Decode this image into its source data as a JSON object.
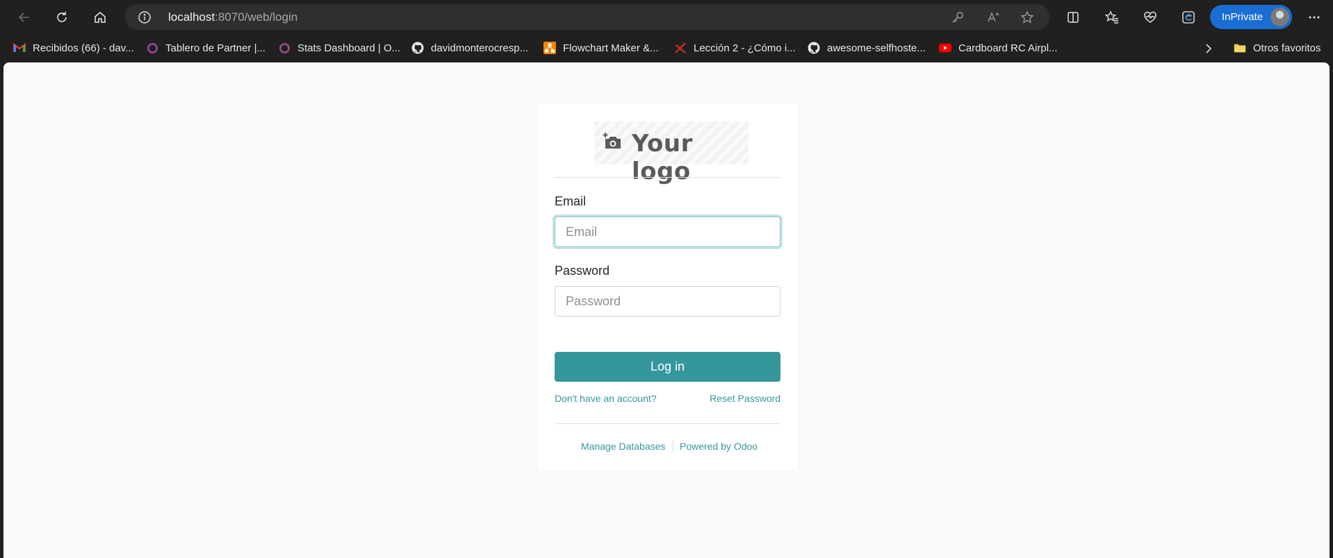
{
  "browser": {
    "url_host": "localhost",
    "url_path": ":8070/web/login",
    "inprivate_label": "InPrivate",
    "bookmarks": [
      {
        "label": "Recibidos (66) - dav...",
        "icon": "gmail-icon"
      },
      {
        "label": "Tablero de Partner |...",
        "icon": "circle-icon"
      },
      {
        "label": "Stats Dashboard | O...",
        "icon": "circle-icon"
      },
      {
        "label": "davidmonterocresp...",
        "icon": "github-icon"
      },
      {
        "label": "Flowchart Maker &...",
        "icon": "drawio-icon"
      },
      {
        "label": "Lección 2 - ¿Cómo i...",
        "icon": "red-x-icon"
      },
      {
        "label": "awesome-selfhoste...",
        "icon": "github-icon"
      },
      {
        "label": "Cardboard RC Airpl...",
        "icon": "youtube-icon"
      }
    ],
    "other_favorites": "Otros favoritos"
  },
  "login": {
    "logo_text": "Your logo",
    "email_label": "Email",
    "email_placeholder": "Email",
    "password_label": "Password",
    "password_placeholder": "Password",
    "login_button": "Log in",
    "signup_link": "Don't have an account?",
    "reset_link": "Reset Password",
    "manage_databases": "Manage Databases",
    "powered_by": "Powered by Odoo"
  },
  "colors": {
    "accent": "#35979c",
    "page_bg": "#f8f9fa",
    "browser_chrome": "#202020",
    "inprivate": "#1a6dd3"
  }
}
